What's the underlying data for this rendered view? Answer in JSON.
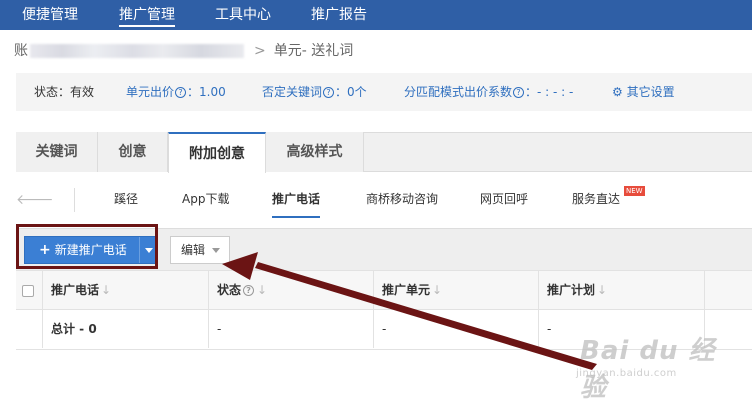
{
  "topnav": {
    "items": [
      {
        "label": "便捷管理"
      },
      {
        "label": "推广管理"
      },
      {
        "label": "工具中心"
      },
      {
        "label": "推广报告"
      }
    ],
    "active_index": 1
  },
  "breadcrumb": {
    "prefix": "账",
    "tail": "单元- 送礼词",
    "separator": ">"
  },
  "status": {
    "state": "状态：有效",
    "unit_bid_label": "单元出价",
    "unit_bid_value": "：1.00",
    "negative_kw_label": "否定关键词",
    "negative_kw_value": "：0个",
    "match_mode_label": "分匹配模式出价系数",
    "match_mode_value": "：- : - : -",
    "other_settings": "其它设置",
    "help_glyph": "?"
  },
  "tabs": [
    {
      "label": "关键词"
    },
    {
      "label": "创意"
    },
    {
      "label": "附加创意"
    },
    {
      "label": "高级样式"
    }
  ],
  "subtabs": [
    {
      "label": "蹊径"
    },
    {
      "label": "App下载"
    },
    {
      "label": "推广电话"
    },
    {
      "label": "商桥移动咨询"
    },
    {
      "label": "网页回呼"
    },
    {
      "label": "服务直达"
    }
  ],
  "new_badge": "NEW",
  "toolbar": {
    "new_label": "新建推广电话",
    "edit_label": "编辑"
  },
  "table": {
    "columns": [
      {
        "label": "推广电话"
      },
      {
        "label": "状态"
      },
      {
        "label": "推广单元"
      },
      {
        "label": "推广计划"
      }
    ],
    "total_row": {
      "label": "总计 - 0",
      "status": "-",
      "unit": "-",
      "plan": "-"
    }
  },
  "watermark": {
    "brand": "Bai du 经验",
    "url": "jingyan.baidu.com"
  },
  "colors": {
    "nav_bg": "#2f5fa6",
    "accent": "#2f6fbf",
    "highlight_box": "#6b1414",
    "new_badge": "#e74c3c"
  }
}
